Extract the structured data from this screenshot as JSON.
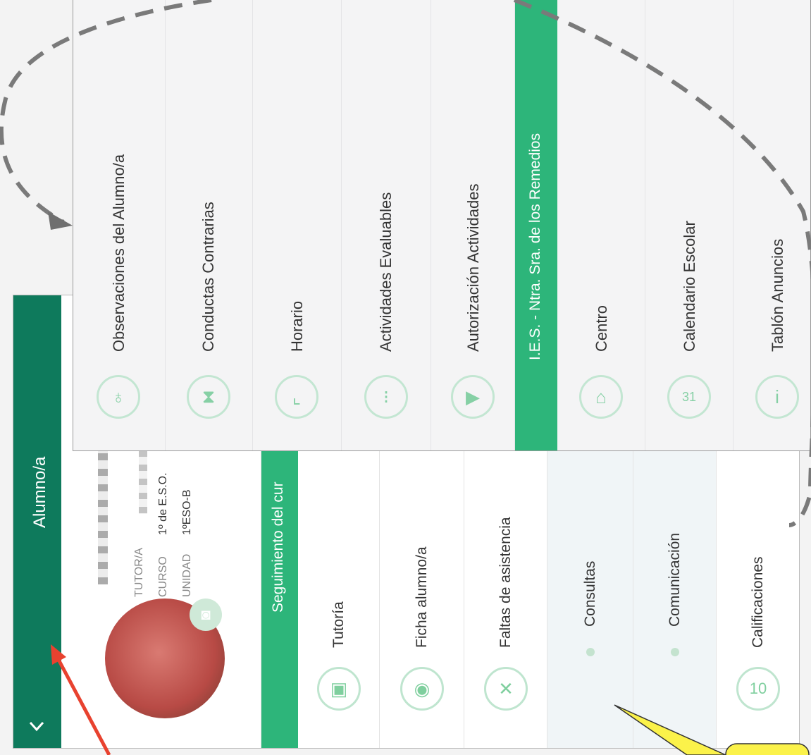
{
  "header": {
    "title": "Alumno/a"
  },
  "student": {
    "tutor_label": "TUTOR/A",
    "curso_label": "CURSO",
    "curso_value": "1º de E.S.O.",
    "unidad_label": "UNIDAD",
    "unidad_value": "1ºESO-B"
  },
  "section_tab": "Seguimiento del cur",
  "back_items": [
    {
      "label": "Tutoría",
      "icon": "person-card-icon"
    },
    {
      "label": "Ficha alumno/a",
      "icon": "profile-icon"
    },
    {
      "label": "Faltas de asistencia",
      "icon": "x-icon"
    },
    {
      "label": "Consultas",
      "icon": "dot"
    },
    {
      "label": "Comunicación",
      "icon": "dot"
    },
    {
      "label": "Calificaciones",
      "icon": "ten-icon"
    }
  ],
  "menu": {
    "items": [
      {
        "label": "Observaciones del Alumno/a",
        "icon": "magnifier-icon"
      },
      {
        "label": "Conductas Contrarias",
        "icon": "hourglass-icon"
      },
      {
        "label": "Horario",
        "icon": "clock-icon"
      },
      {
        "label": "Actividades Evaluables",
        "icon": "list-icon"
      },
      {
        "label": "Autorización Actividades",
        "icon": "ticket-icon"
      }
    ],
    "school_header": "I.E.S. - Ntra. Sra. de los Remedios",
    "school_items": [
      {
        "label": "Centro",
        "icon": "building-icon"
      },
      {
        "label": "Calendario Escolar",
        "icon": "calendar-icon"
      },
      {
        "label": "Tablón Anuncios",
        "icon": "info-icon"
      }
    ]
  },
  "colors": {
    "header": "#0e7a5c",
    "accent": "#2db57a",
    "dashed": "#7a7a7a",
    "arrow": "#e8422f",
    "callout": "#fbf24a"
  }
}
